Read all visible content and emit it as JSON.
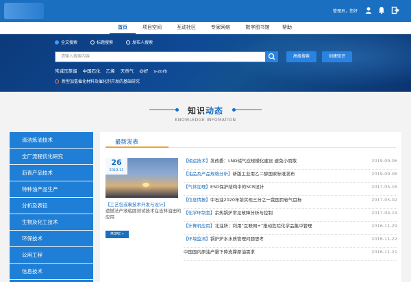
{
  "header": {
    "user_text": "管理员，您好"
  },
  "nav": {
    "items": [
      "首页",
      "项目空间",
      "互动社区",
      "专家网络",
      "数字图书馆",
      "帮助"
    ],
    "active_index": 0
  },
  "search": {
    "options": [
      "全文搜索",
      "标题搜索",
      "发布人搜索"
    ],
    "selected": 0,
    "placeholder": "请输入搜索内容",
    "advanced_label": "高级搜索",
    "create_label": "创建知识",
    "hot_words": [
      "常减压蒸馏",
      "中国石化",
      "乙烯",
      "天然气",
      "@好",
      "s-zorb"
    ],
    "news_line": "新型加氢催化材料及催化剂开发的基础研究"
  },
  "section": {
    "title_left": "知识",
    "title_right": "动态",
    "subtitle": "KNOWLEDGE INFOMATION"
  },
  "sidebar": {
    "items": [
      "清洁炼油技术",
      "全厂流程优化研究",
      "沥青产品技术",
      "特种油产品生产",
      "分析及表征",
      "生物及化工技术",
      "环保技术",
      "公用工程",
      "信息技术"
    ]
  },
  "panel": {
    "tab": "最新发表",
    "feature": {
      "day": "26",
      "year_month": "2019-11",
      "title": "【工艺包或裹技术开发与设计】",
      "desc": "遗憾法产液粘圆测试技术在吉林油田的应用",
      "more": "MORE »"
    },
    "news": [
      {
        "cat": "【储运技术】",
        "text": "发改委：LNG储气应规模化建设 避免小而散",
        "date": "2019-09-06"
      },
      {
        "cat": "【油品及产品规格分析】",
        "text": "新版工业用乙二醇国家标准发布",
        "date": "2019-09-06"
      },
      {
        "cat": "【气体加理】",
        "text": "ESD保护结构中的SCR设计",
        "date": "2017-05-16"
      },
      {
        "cat": "【信息情报】",
        "text": "中石油2020年前实现三分之一我国页岩气目标",
        "date": "2017-05-02"
      },
      {
        "cat": "【化学环制氢】",
        "text": "余热锅炉常见故障分析与控制",
        "date": "2017-04-19"
      },
      {
        "cat": "【计算机应用】",
        "text": "北油所：利用“互联网+”推动危险化学品集中管理",
        "date": "2016-11-29"
      },
      {
        "cat": "【环境监测】",
        "text": "锅炉炉水水质管理问题思考",
        "date": "2016-11-22"
      },
      {
        "cat": "",
        "text": "中国国内原油产量下降支撑原油需求",
        "date": "2016-11-21"
      }
    ]
  },
  "colors": {
    "primary": "#1a6fc0",
    "sidebar": "#1f7fd6",
    "accent": "#f0a030"
  },
  "icons": [
    "user-icon",
    "bell-icon",
    "logout-icon",
    "search-icon",
    "news-alert-icon"
  ]
}
